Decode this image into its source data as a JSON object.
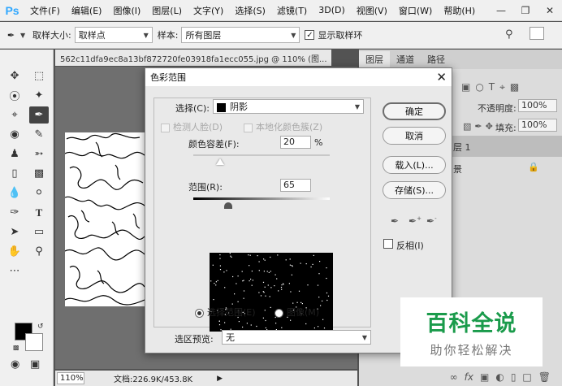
{
  "app": {
    "logo": "Ps"
  },
  "menubar": {
    "items": [
      "文件(F)",
      "编辑(E)",
      "图像(I)",
      "图层(L)",
      "文字(Y)",
      "选择(S)",
      "滤镜(T)",
      "3D(D)",
      "视图(V)",
      "窗口(W)",
      "帮助(H)"
    ]
  },
  "options": {
    "sample_size_label": "取样大小:",
    "sample_size_value": "取样点",
    "sample_label": "样本:",
    "sample_value": "所有图层",
    "show_ring_label": "显示取样环"
  },
  "document": {
    "tab_title": "562c11dfa9ec8a13bf872720fe03918fa1ecc055.jpg @ 110% (图...",
    "zoom": "110%",
    "doc_info": "文档:226.9K/453.8K"
  },
  "panels": {
    "tabs": [
      "图层",
      "通道",
      "路径"
    ],
    "opacity_label": "不透明度:",
    "opacity_value": "100%",
    "fill_label": "填充:",
    "fill_value": "100%",
    "layer1_partial": "层 1",
    "layer2_partial": "景"
  },
  "dialog": {
    "title": "色彩范围",
    "select_label": "选择(C):",
    "select_value": "阴影",
    "detect_faces_label": "检测人脸(D)",
    "localized_label": "本地化颜色簇(Z)",
    "fuzziness_label": "颜色容差(F):",
    "fuzziness_value": "20",
    "fuzziness_unit": "%",
    "range_label": "范围(R):",
    "range_value": "65",
    "radio_selection": "选择范围(E)",
    "radio_image": "图像(M)",
    "preview_label": "选区预览:",
    "preview_value": "无",
    "ok": "确定",
    "cancel": "取消",
    "load": "载入(L)...",
    "save": "存储(S)...",
    "invert_label": "反相(I)"
  },
  "watermark": {
    "main": "百科全说",
    "sub": "助你轻松解决"
  },
  "colors": {
    "ps_blue": "#31a8ff",
    "watermark_green": "#1a9b4b",
    "foreground": "#000000",
    "background": "#ffffff"
  }
}
